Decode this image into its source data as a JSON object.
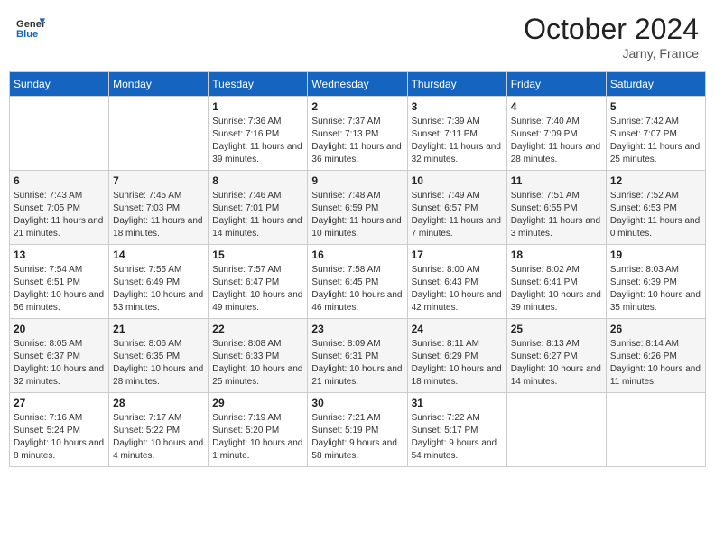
{
  "header": {
    "logo_general": "General",
    "logo_blue": "Blue",
    "month_title": "October 2024",
    "location": "Jarny, France"
  },
  "calendar": {
    "days_of_week": [
      "Sunday",
      "Monday",
      "Tuesday",
      "Wednesday",
      "Thursday",
      "Friday",
      "Saturday"
    ],
    "weeks": [
      [
        {
          "day": "",
          "info": ""
        },
        {
          "day": "",
          "info": ""
        },
        {
          "day": "1",
          "info": "Sunrise: 7:36 AM\nSunset: 7:16 PM\nDaylight: 11 hours and 39 minutes."
        },
        {
          "day": "2",
          "info": "Sunrise: 7:37 AM\nSunset: 7:13 PM\nDaylight: 11 hours and 36 minutes."
        },
        {
          "day": "3",
          "info": "Sunrise: 7:39 AM\nSunset: 7:11 PM\nDaylight: 11 hours and 32 minutes."
        },
        {
          "day": "4",
          "info": "Sunrise: 7:40 AM\nSunset: 7:09 PM\nDaylight: 11 hours and 28 minutes."
        },
        {
          "day": "5",
          "info": "Sunrise: 7:42 AM\nSunset: 7:07 PM\nDaylight: 11 hours and 25 minutes."
        }
      ],
      [
        {
          "day": "6",
          "info": "Sunrise: 7:43 AM\nSunset: 7:05 PM\nDaylight: 11 hours and 21 minutes."
        },
        {
          "day": "7",
          "info": "Sunrise: 7:45 AM\nSunset: 7:03 PM\nDaylight: 11 hours and 18 minutes."
        },
        {
          "day": "8",
          "info": "Sunrise: 7:46 AM\nSunset: 7:01 PM\nDaylight: 11 hours and 14 minutes."
        },
        {
          "day": "9",
          "info": "Sunrise: 7:48 AM\nSunset: 6:59 PM\nDaylight: 11 hours and 10 minutes."
        },
        {
          "day": "10",
          "info": "Sunrise: 7:49 AM\nSunset: 6:57 PM\nDaylight: 11 hours and 7 minutes."
        },
        {
          "day": "11",
          "info": "Sunrise: 7:51 AM\nSunset: 6:55 PM\nDaylight: 11 hours and 3 minutes."
        },
        {
          "day": "12",
          "info": "Sunrise: 7:52 AM\nSunset: 6:53 PM\nDaylight: 11 hours and 0 minutes."
        }
      ],
      [
        {
          "day": "13",
          "info": "Sunrise: 7:54 AM\nSunset: 6:51 PM\nDaylight: 10 hours and 56 minutes."
        },
        {
          "day": "14",
          "info": "Sunrise: 7:55 AM\nSunset: 6:49 PM\nDaylight: 10 hours and 53 minutes."
        },
        {
          "day": "15",
          "info": "Sunrise: 7:57 AM\nSunset: 6:47 PM\nDaylight: 10 hours and 49 minutes."
        },
        {
          "day": "16",
          "info": "Sunrise: 7:58 AM\nSunset: 6:45 PM\nDaylight: 10 hours and 46 minutes."
        },
        {
          "day": "17",
          "info": "Sunrise: 8:00 AM\nSunset: 6:43 PM\nDaylight: 10 hours and 42 minutes."
        },
        {
          "day": "18",
          "info": "Sunrise: 8:02 AM\nSunset: 6:41 PM\nDaylight: 10 hours and 39 minutes."
        },
        {
          "day": "19",
          "info": "Sunrise: 8:03 AM\nSunset: 6:39 PM\nDaylight: 10 hours and 35 minutes."
        }
      ],
      [
        {
          "day": "20",
          "info": "Sunrise: 8:05 AM\nSunset: 6:37 PM\nDaylight: 10 hours and 32 minutes."
        },
        {
          "day": "21",
          "info": "Sunrise: 8:06 AM\nSunset: 6:35 PM\nDaylight: 10 hours and 28 minutes."
        },
        {
          "day": "22",
          "info": "Sunrise: 8:08 AM\nSunset: 6:33 PM\nDaylight: 10 hours and 25 minutes."
        },
        {
          "day": "23",
          "info": "Sunrise: 8:09 AM\nSunset: 6:31 PM\nDaylight: 10 hours and 21 minutes."
        },
        {
          "day": "24",
          "info": "Sunrise: 8:11 AM\nSunset: 6:29 PM\nDaylight: 10 hours and 18 minutes."
        },
        {
          "day": "25",
          "info": "Sunrise: 8:13 AM\nSunset: 6:27 PM\nDaylight: 10 hours and 14 minutes."
        },
        {
          "day": "26",
          "info": "Sunrise: 8:14 AM\nSunset: 6:26 PM\nDaylight: 10 hours and 11 minutes."
        }
      ],
      [
        {
          "day": "27",
          "info": "Sunrise: 7:16 AM\nSunset: 5:24 PM\nDaylight: 10 hours and 8 minutes."
        },
        {
          "day": "28",
          "info": "Sunrise: 7:17 AM\nSunset: 5:22 PM\nDaylight: 10 hours and 4 minutes."
        },
        {
          "day": "29",
          "info": "Sunrise: 7:19 AM\nSunset: 5:20 PM\nDaylight: 10 hours and 1 minute."
        },
        {
          "day": "30",
          "info": "Sunrise: 7:21 AM\nSunset: 5:19 PM\nDaylight: 9 hours and 58 minutes."
        },
        {
          "day": "31",
          "info": "Sunrise: 7:22 AM\nSunset: 5:17 PM\nDaylight: 9 hours and 54 minutes."
        },
        {
          "day": "",
          "info": ""
        },
        {
          "day": "",
          "info": ""
        }
      ]
    ]
  }
}
